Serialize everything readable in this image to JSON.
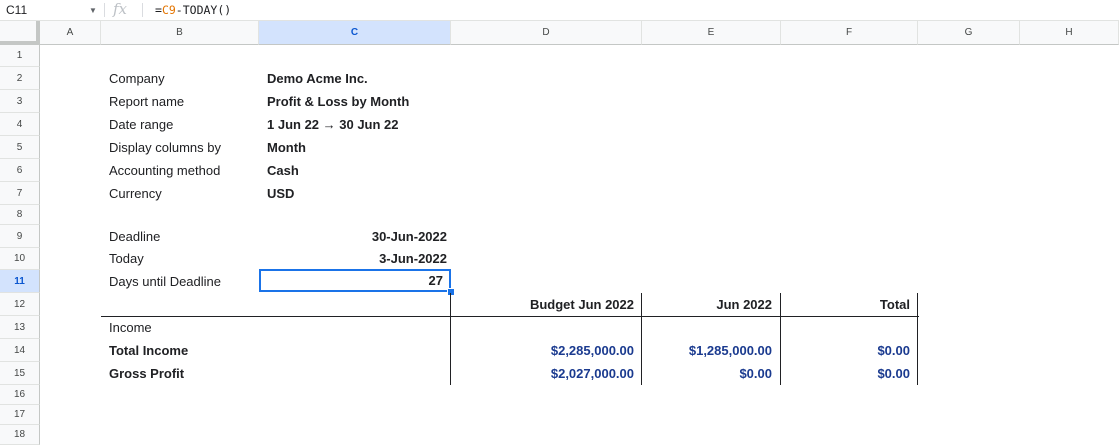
{
  "formula_bar": {
    "name_box": "C11",
    "formula_prefix": "=",
    "formula_ref": "C9",
    "formula_rest": "-TODAY()"
  },
  "columns": [
    "A",
    "B",
    "C",
    "D",
    "E",
    "F",
    "G",
    "H"
  ],
  "selected_column": "C",
  "rows": [
    "1",
    "2",
    "3",
    "4",
    "5",
    "6",
    "7",
    "8",
    "9",
    "10",
    "11",
    "12",
    "13",
    "14",
    "15",
    "16",
    "17",
    "18"
  ],
  "selected_row": "11",
  "report_meta": [
    {
      "label": "Company",
      "value": "Demo Acme Inc."
    },
    {
      "label": "Report name",
      "value": "Profit & Loss by Month"
    },
    {
      "label": "Date range",
      "value": "1 Jun 22 → 30 Jun 22"
    },
    {
      "label": "Display columns by",
      "value": "Month"
    },
    {
      "label": "Accounting method",
      "value": "Cash"
    },
    {
      "label": "Currency",
      "value": "USD"
    }
  ],
  "deadline": {
    "deadline_label": "Deadline",
    "deadline_value": "30-Jun-2022",
    "today_label": "Today",
    "today_value": "3-Jun-2022",
    "days_label": "Days until Deadline",
    "days_value": "27"
  },
  "table": {
    "headers": [
      "Budget Jun 2022",
      "Jun 2022",
      "Total"
    ],
    "rows": [
      {
        "label": "Income",
        "values": [
          "",
          "",
          ""
        ],
        "bold": false
      },
      {
        "label": "Total Income",
        "values": [
          "$2,285,000.00",
          "$1,285,000.00",
          "$0.00"
        ],
        "bold": true
      },
      {
        "label": "Gross Profit",
        "values": [
          "$2,027,000.00",
          "$0.00",
          "$0.00"
        ],
        "bold": true
      }
    ]
  },
  "colors": {
    "selection": "#1a73e8",
    "currency_text": "#1a3a8f",
    "formula_ref": "#e37400"
  }
}
